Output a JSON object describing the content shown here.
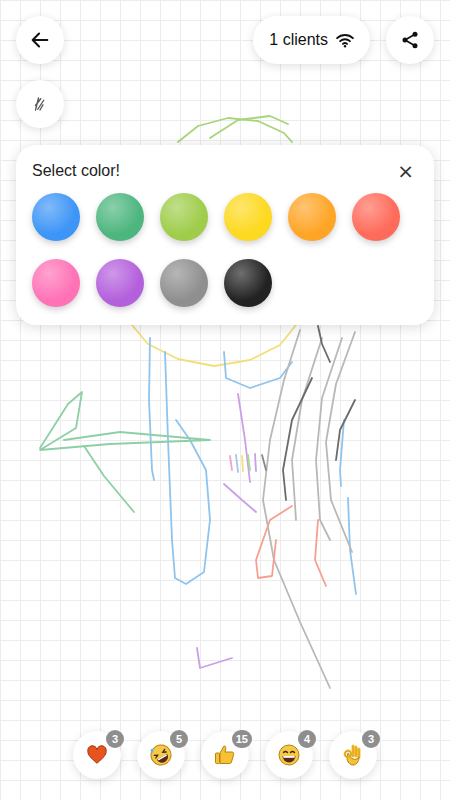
{
  "top_bar": {
    "connection": {
      "label": "1 clients"
    }
  },
  "color_picker": {
    "title": "Select color!",
    "close": "×",
    "colors": [
      {
        "color": "#3d95f7"
      },
      {
        "color": "#4db67f"
      },
      {
        "color": "#9fcd4b"
      },
      {
        "color": "#fdd91f"
      },
      {
        "color": "#ffa526"
      },
      {
        "color": "#ff6b5a"
      },
      {
        "color": "#ff72b6"
      },
      {
        "color": "#b460dc"
      },
      {
        "color": "#8f8f8f"
      },
      {
        "color": "#222222"
      }
    ]
  },
  "strokes": [
    {
      "color": "#a8d47a",
      "points": [
        178,
        142,
        198,
        126,
        228,
        118,
        258,
        121,
        284,
        133,
        292,
        142
      ]
    },
    {
      "color": "#a8d47a",
      "points": [
        210,
        138,
        238,
        120,
        270,
        116,
        288,
        124
      ]
    },
    {
      "color": "#f2df7a",
      "points": [
        132,
        325,
        148,
        344,
        178,
        359,
        214,
        366,
        250,
        360,
        280,
        345,
        296,
        325
      ]
    },
    {
      "color": "#8fc4ee",
      "points": [
        150,
        338,
        149,
        400,
        152,
        470,
        154,
        480
      ]
    },
    {
      "color": "#8fc4ee",
      "points": [
        165,
        352,
        168,
        440,
        172,
        540,
        175,
        578,
        186,
        584,
        204,
        572,
        210,
        520,
        206,
        470,
        190,
        440,
        176,
        420
      ]
    },
    {
      "color": "#8fc4ee",
      "points": [
        224,
        352,
        226,
        378,
        250,
        388,
        280,
        378,
        292,
        362
      ]
    },
    {
      "color": "#8fc4ee",
      "points": [
        344,
        420,
        340,
        470,
        341,
        486
      ]
    },
    {
      "color": "#8fc4ee",
      "points": [
        348,
        498,
        350,
        550,
        356,
        594
      ]
    },
    {
      "color": "#8ecfa6",
      "points": [
        40,
        448,
        68,
        404,
        82,
        392,
        76,
        428,
        40,
        450,
        110,
        444,
        210,
        440,
        120,
        432,
        64,
        440
      ]
    },
    {
      "color": "#8ecfa6",
      "points": [
        84,
        446,
        104,
        476,
        134,
        512
      ]
    },
    {
      "color": "#b8b8b8",
      "points": [
        300,
        330,
        284,
        380,
        270,
        440,
        263,
        500,
        274,
        560,
        300,
        622,
        330,
        688
      ]
    },
    {
      "color": "#b8b8b8",
      "points": [
        322,
        338,
        302,
        400,
        292,
        460,
        296,
        520
      ]
    },
    {
      "color": "#b8b8b8",
      "points": [
        342,
        338,
        322,
        398,
        316,
        460,
        320,
        520,
        330,
        540
      ]
    },
    {
      "color": "#b8b8b8",
      "points": [
        355,
        332,
        336,
        384,
        326,
        442,
        331,
        500,
        352,
        552
      ]
    },
    {
      "color": "#6b6b6b",
      "points": [
        312,
        378,
        292,
        420,
        283,
        470,
        286,
        500
      ]
    },
    {
      "color": "#6b6b6b",
      "points": [
        318,
        326,
        322,
        344,
        330,
        362
      ]
    },
    {
      "color": "#6b6b6b",
      "points": [
        355,
        400,
        340,
        430,
        336,
        460
      ]
    },
    {
      "color": "#c9a0e8",
      "points": [
        238,
        394,
        245,
        440,
        250,
        482
      ]
    },
    {
      "color": "#c9a0e8",
      "points": [
        224,
        484,
        242,
        500,
        256,
        512
      ]
    },
    {
      "color": "#c9a0e8",
      "points": [
        197,
        648,
        200,
        668,
        232,
        658
      ]
    },
    {
      "color": "#f5a08e",
      "points": [
        292,
        506,
        270,
        520,
        256,
        560,
        258,
        578,
        272,
        576,
        276,
        540
      ]
    },
    {
      "color": "#f5a08e",
      "points": [
        318,
        520,
        315,
        560,
        326,
        586
      ]
    },
    {
      "color": "#f4a3cf",
      "points": [
        230,
        456,
        232,
        470
      ]
    },
    {
      "color": "#9fc5f0",
      "points": [
        236,
        455,
        238,
        472
      ]
    },
    {
      "color": "#f2df7a",
      "points": [
        242,
        456,
        243,
        471
      ]
    },
    {
      "color": "#a9d98f",
      "points": [
        248,
        455,
        250,
        470
      ]
    },
    {
      "color": "#c9a0e8",
      "points": [
        255,
        454,
        256,
        471
      ]
    },
    {
      "color": "#888888",
      "points": [
        262,
        455,
        266,
        470
      ]
    }
  ],
  "reactions": [
    {
      "kind": "heart",
      "count": "3"
    },
    {
      "kind": "rofl",
      "count": "5"
    },
    {
      "kind": "thumbs-up",
      "count": "15"
    },
    {
      "kind": "grin",
      "count": "4"
    },
    {
      "kind": "ok-hand",
      "count": "3"
    }
  ]
}
